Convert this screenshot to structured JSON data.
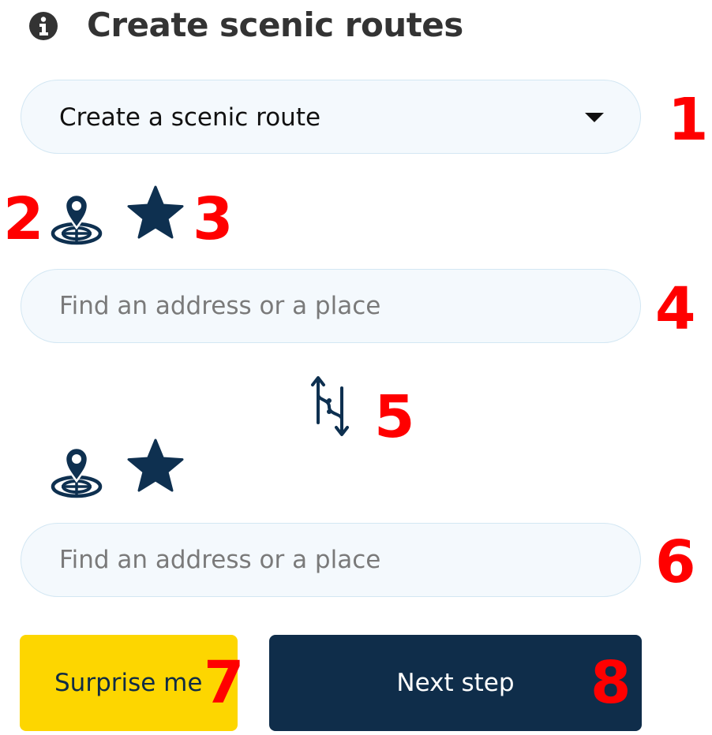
{
  "header": {
    "title": "Create scenic routes",
    "icon": "info-circle-icon"
  },
  "route_select": {
    "selected": "Create a scenic route",
    "icon": "caret-down-icon"
  },
  "start": {
    "location_icon": "location-target-pin-icon",
    "favorite_icon": "star-icon",
    "placeholder": "Find an address or a place",
    "value": ""
  },
  "swap": {
    "icon": "swap-route-arrows-icon"
  },
  "destination": {
    "location_icon": "location-target-pin-icon",
    "favorite_icon": "star-icon",
    "placeholder": "Find an address or a place",
    "value": ""
  },
  "buttons": {
    "surprise_label": "Surprise me",
    "next_label": "Next step"
  },
  "annotations": [
    "1",
    "2",
    "3",
    "4",
    "5",
    "6",
    "7",
    "8"
  ],
  "colors": {
    "accent_yellow": "#fdd600",
    "navy": "#0f2d4a",
    "icon_navy": "#0e3050",
    "field_bg": "#f4f9fd",
    "field_border": "#d3e7f3",
    "annotation_red": "#ff0000",
    "title": "#333333"
  }
}
